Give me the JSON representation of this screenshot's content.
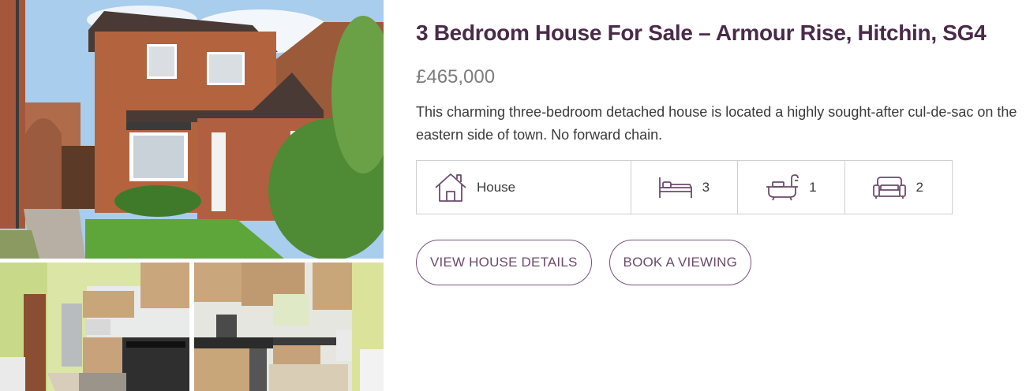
{
  "listing": {
    "title": "3 Bedroom House For Sale – Armour Rise, Hitchin, SG4",
    "price": "£465,000",
    "description": "This charming three-bedroom detached house is located a highly sought-after cul-de-sac on the eastern side of town. No forward chain."
  },
  "features": {
    "type": {
      "icon": "house-icon",
      "value": "House"
    },
    "bedrooms": {
      "icon": "bed-icon",
      "value": "3"
    },
    "bathrooms": {
      "icon": "bath-icon",
      "value": "1"
    },
    "receptions": {
      "icon": "sofa-icon",
      "value": "2"
    }
  },
  "buttons": {
    "details_label": "VIEW HOUSE DETAILS",
    "viewing_label": "BOOK A VIEWING"
  },
  "colors": {
    "accent": "#6d4a6d",
    "title": "#4a2a4a",
    "price": "#7d7d7d",
    "border": "#cfcfcf"
  }
}
